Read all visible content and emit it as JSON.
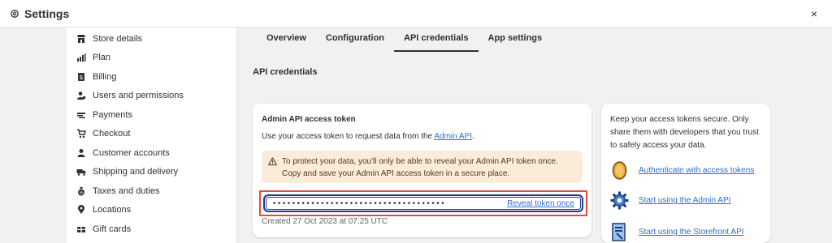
{
  "window": {
    "title": "Settings",
    "close_label": "×"
  },
  "sidebar": {
    "items": [
      {
        "label": "Store details",
        "icon": "store-icon"
      },
      {
        "label": "Plan",
        "icon": "plan-chart-icon"
      },
      {
        "label": "Billing",
        "icon": "billing-icon"
      },
      {
        "label": "Users and permissions",
        "icon": "users-icon"
      },
      {
        "label": "Payments",
        "icon": "payments-icon"
      },
      {
        "label": "Checkout",
        "icon": "cart-icon"
      },
      {
        "label": "Customer accounts",
        "icon": "person-icon"
      },
      {
        "label": "Shipping and delivery",
        "icon": "truck-icon"
      },
      {
        "label": "Taxes and duties",
        "icon": "tax-bag-icon"
      },
      {
        "label": "Locations",
        "icon": "location-pin-icon"
      },
      {
        "label": "Gift cards",
        "icon": "gift-card-icon"
      }
    ]
  },
  "tabs": [
    {
      "label": "Overview"
    },
    {
      "label": "Configuration"
    },
    {
      "label": "API credentials",
      "active": true
    },
    {
      "label": "App settings"
    }
  ],
  "main": {
    "section_title": "API credentials",
    "token_card": {
      "title": "Admin API access token",
      "desc_prefix": "Use your access token to request data from the ",
      "desc_link": "Admin API",
      "desc_suffix": ".",
      "warning_line1": "To protect your data, you'll only be able to reveal your Admin API token once.",
      "warning_line2": "Copy and save your Admin API access token in a secure place.",
      "token_masked": "••••••••••••••••••••••••••••••••••••",
      "reveal_label": "Reveal token once",
      "created": "Created 27 Oct 2023 at 07:25 UTC"
    },
    "resources": {
      "blurb": "Keep your access tokens secure. Only share them with developers that you trust to safely access your data.",
      "links": [
        {
          "label": "Authenticate with access tokens",
          "icon": "token-coin-icon"
        },
        {
          "label": "Start using the Admin API",
          "icon": "gear-cog-icon"
        },
        {
          "label": "Start using the Storefront API",
          "icon": "storefront-doc-icon"
        }
      ]
    }
  },
  "colors": {
    "accent_link": "#2c6ecb",
    "warning_bg": "#fbebd9",
    "highlight_border": "#e04e3a",
    "focus_border": "#1d3d8f"
  }
}
